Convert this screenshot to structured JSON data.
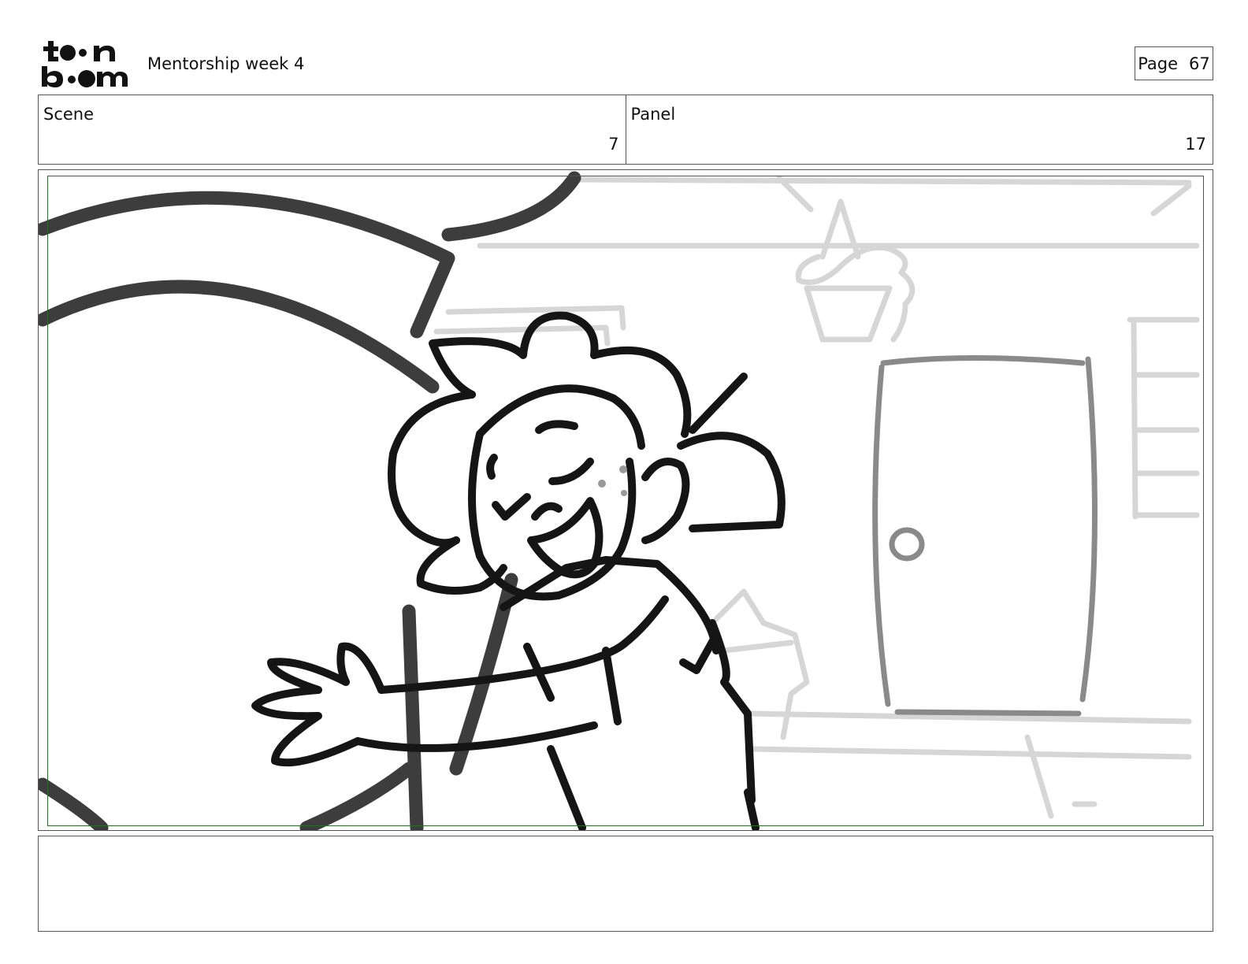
{
  "header": {
    "logo_text": "toonboom",
    "project_title": "Mentorship week 4",
    "page_label": "Page",
    "page_number": "67"
  },
  "info": {
    "scene_label": "Scene",
    "scene_value": "7",
    "panel_label": "Panel",
    "panel_value": "17"
  },
  "notes": {
    "text": ""
  }
}
